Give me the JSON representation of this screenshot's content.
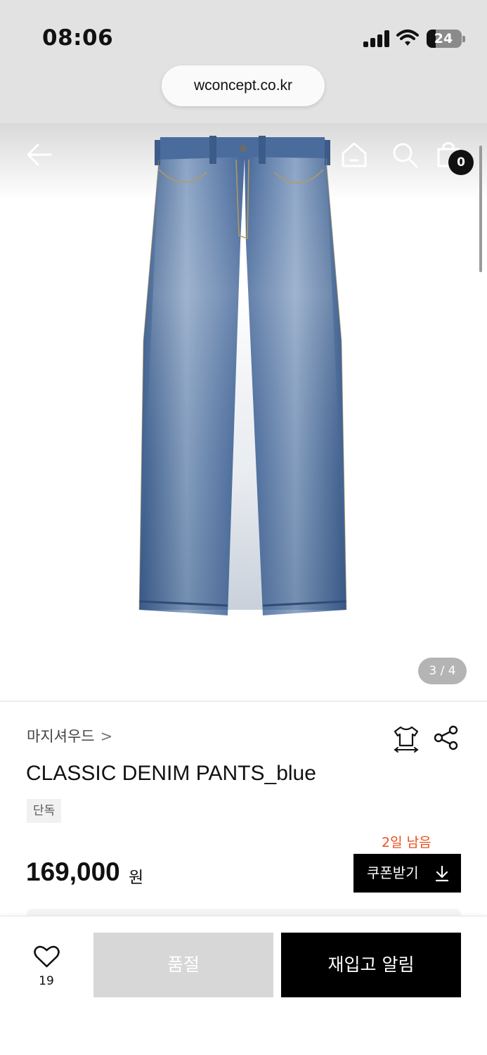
{
  "status_bar": {
    "time": "08:06",
    "battery": "24"
  },
  "browser": {
    "url": "wconcept.co.kr"
  },
  "header": {
    "cart_count": "0"
  },
  "gallery": {
    "page_indicator": "3 / 4"
  },
  "product": {
    "brand": "마지셔우드",
    "brand_chevron": ">",
    "title": "CLASSIC DENIM PANTS_blue",
    "badge": "단독",
    "days_left": "2일 남음",
    "price": "169,000",
    "price_unit": "원",
    "coupon_label": "쿠폰받기"
  },
  "bottom_bar": {
    "like_count": "19",
    "soldout_label": "품절",
    "restock_label": "재입고 알림"
  },
  "colors": {
    "accent_orange": "#e8501e",
    "primary_black": "#000000",
    "disabled_gray": "#d7d7d7"
  },
  "icons": [
    "back-arrow-icon",
    "home-icon",
    "search-icon",
    "shopping-bag-icon",
    "hanger-icon",
    "share-icon",
    "download-icon",
    "heart-icon",
    "signal-icon",
    "wifi-icon",
    "battery-icon"
  ]
}
